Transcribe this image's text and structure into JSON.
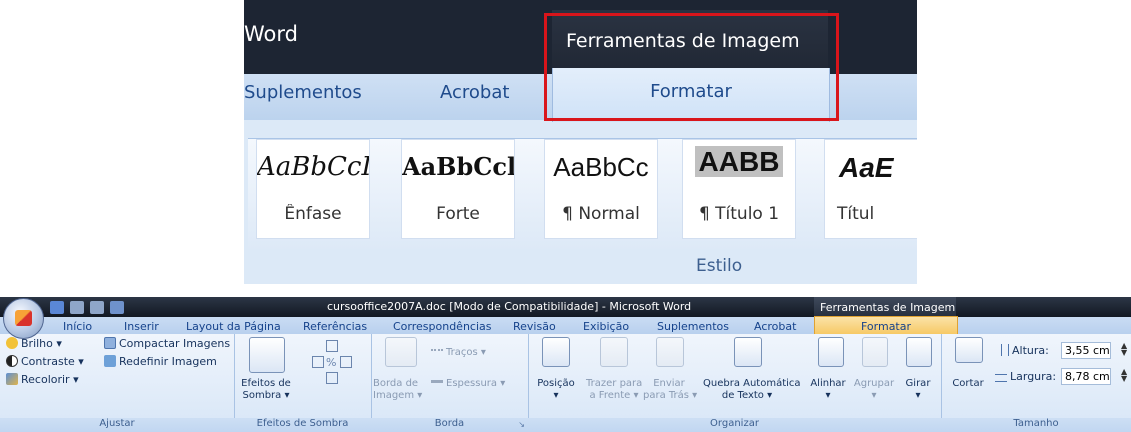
{
  "zoom": {
    "app_title": "Word",
    "context_title": "Ferramentas de Imagem",
    "tabs": [
      "Suplementos",
      "Acrobat"
    ],
    "context_tab": "Formatar",
    "styles": [
      {
        "sample": "AaBbCcI",
        "name": "Ênfase"
      },
      {
        "sample": "AaBbCcl",
        "name": "Forte"
      },
      {
        "sample": "AaBbCc",
        "name": "¶ Normal"
      },
      {
        "sample": "AABB",
        "name": "¶ Título 1"
      },
      {
        "sample": "AaE",
        "name": "Títul"
      }
    ],
    "group_label": "Estilo",
    "highlight_color": "#d9151b"
  },
  "ribbon": {
    "window_title": "cursooffice2007A.doc [Modo de Compatibilidade] - Microsoft Word",
    "context_title": "Ferramentas de Imagem",
    "tabs": [
      "Início",
      "Inserir",
      "Layout da Página",
      "Referências",
      "Correspondências",
      "Revisão",
      "Exibição",
      "Suplementos",
      "Acrobat"
    ],
    "context_tab": "Formatar",
    "ajustar": {
      "brilho": "Brilho ▾",
      "contraste": "Contraste ▾",
      "recolorir": "Recolorir ▾",
      "compactar": "Compactar Imagens",
      "redefinir": "Redefinir Imagem",
      "label": "Ajustar"
    },
    "sombra": {
      "efeitos_line1": "Efeitos de",
      "efeitos_line2": "Sombra ▾",
      "label": "Efeitos de Sombra"
    },
    "borda": {
      "borda_line1": "Borda de",
      "borda_line2": "Imagem ▾",
      "tracos": "Traços ▾",
      "espessura": "Espessura ▾",
      "label": "Borda"
    },
    "organizar": {
      "posicao": "Posição",
      "posicao_arrow": "▾",
      "trazer_line1": "Trazer para",
      "trazer_line2": "a Frente ▾",
      "enviar_line1": "Enviar",
      "enviar_line2": "para Trás ▾",
      "quebra_line1": "Quebra Automática",
      "quebra_line2": "de Texto ▾",
      "alinhar": "Alinhar",
      "alinhar_arrow": "▾",
      "agrupar": "Agrupar",
      "agrupar_arrow": "▾",
      "girar": "Girar",
      "girar_arrow": "▾",
      "label": "Organizar"
    },
    "tamanho": {
      "cortar": "Cortar",
      "altura_label": "Altura:",
      "altura_value": "3,55 cm",
      "largura_label": "Largura:",
      "largura_value": "8,78 cm",
      "label": "Tamanho"
    },
    "colors": {
      "title_bar": "#121822",
      "context_tab": "#f6c65e",
      "tab_text": "#15428b"
    }
  }
}
